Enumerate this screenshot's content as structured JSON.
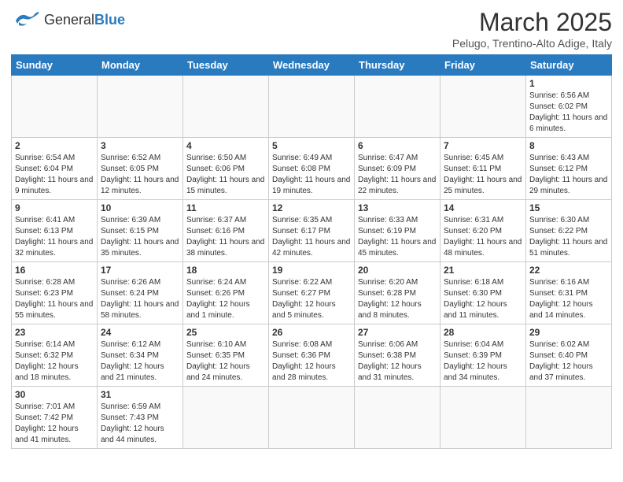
{
  "header": {
    "logo_general": "General",
    "logo_blue": "Blue",
    "month_title": "March 2025",
    "subtitle": "Pelugo, Trentino-Alto Adige, Italy"
  },
  "weekdays": [
    "Sunday",
    "Monday",
    "Tuesday",
    "Wednesday",
    "Thursday",
    "Friday",
    "Saturday"
  ],
  "weeks": [
    [
      {
        "day": "",
        "info": ""
      },
      {
        "day": "",
        "info": ""
      },
      {
        "day": "",
        "info": ""
      },
      {
        "day": "",
        "info": ""
      },
      {
        "day": "",
        "info": ""
      },
      {
        "day": "",
        "info": ""
      },
      {
        "day": "1",
        "info": "Sunrise: 6:56 AM\nSunset: 6:02 PM\nDaylight: 11 hours and 6 minutes."
      }
    ],
    [
      {
        "day": "2",
        "info": "Sunrise: 6:54 AM\nSunset: 6:04 PM\nDaylight: 11 hours and 9 minutes."
      },
      {
        "day": "3",
        "info": "Sunrise: 6:52 AM\nSunset: 6:05 PM\nDaylight: 11 hours and 12 minutes."
      },
      {
        "day": "4",
        "info": "Sunrise: 6:50 AM\nSunset: 6:06 PM\nDaylight: 11 hours and 15 minutes."
      },
      {
        "day": "5",
        "info": "Sunrise: 6:49 AM\nSunset: 6:08 PM\nDaylight: 11 hours and 19 minutes."
      },
      {
        "day": "6",
        "info": "Sunrise: 6:47 AM\nSunset: 6:09 PM\nDaylight: 11 hours and 22 minutes."
      },
      {
        "day": "7",
        "info": "Sunrise: 6:45 AM\nSunset: 6:11 PM\nDaylight: 11 hours and 25 minutes."
      },
      {
        "day": "8",
        "info": "Sunrise: 6:43 AM\nSunset: 6:12 PM\nDaylight: 11 hours and 29 minutes."
      }
    ],
    [
      {
        "day": "9",
        "info": "Sunrise: 6:41 AM\nSunset: 6:13 PM\nDaylight: 11 hours and 32 minutes."
      },
      {
        "day": "10",
        "info": "Sunrise: 6:39 AM\nSunset: 6:15 PM\nDaylight: 11 hours and 35 minutes."
      },
      {
        "day": "11",
        "info": "Sunrise: 6:37 AM\nSunset: 6:16 PM\nDaylight: 11 hours and 38 minutes."
      },
      {
        "day": "12",
        "info": "Sunrise: 6:35 AM\nSunset: 6:17 PM\nDaylight: 11 hours and 42 minutes."
      },
      {
        "day": "13",
        "info": "Sunrise: 6:33 AM\nSunset: 6:19 PM\nDaylight: 11 hours and 45 minutes."
      },
      {
        "day": "14",
        "info": "Sunrise: 6:31 AM\nSunset: 6:20 PM\nDaylight: 11 hours and 48 minutes."
      },
      {
        "day": "15",
        "info": "Sunrise: 6:30 AM\nSunset: 6:22 PM\nDaylight: 11 hours and 51 minutes."
      }
    ],
    [
      {
        "day": "16",
        "info": "Sunrise: 6:28 AM\nSunset: 6:23 PM\nDaylight: 11 hours and 55 minutes."
      },
      {
        "day": "17",
        "info": "Sunrise: 6:26 AM\nSunset: 6:24 PM\nDaylight: 11 hours and 58 minutes."
      },
      {
        "day": "18",
        "info": "Sunrise: 6:24 AM\nSunset: 6:26 PM\nDaylight: 12 hours and 1 minute."
      },
      {
        "day": "19",
        "info": "Sunrise: 6:22 AM\nSunset: 6:27 PM\nDaylight: 12 hours and 5 minutes."
      },
      {
        "day": "20",
        "info": "Sunrise: 6:20 AM\nSunset: 6:28 PM\nDaylight: 12 hours and 8 minutes."
      },
      {
        "day": "21",
        "info": "Sunrise: 6:18 AM\nSunset: 6:30 PM\nDaylight: 12 hours and 11 minutes."
      },
      {
        "day": "22",
        "info": "Sunrise: 6:16 AM\nSunset: 6:31 PM\nDaylight: 12 hours and 14 minutes."
      }
    ],
    [
      {
        "day": "23",
        "info": "Sunrise: 6:14 AM\nSunset: 6:32 PM\nDaylight: 12 hours and 18 minutes."
      },
      {
        "day": "24",
        "info": "Sunrise: 6:12 AM\nSunset: 6:34 PM\nDaylight: 12 hours and 21 minutes."
      },
      {
        "day": "25",
        "info": "Sunrise: 6:10 AM\nSunset: 6:35 PM\nDaylight: 12 hours and 24 minutes."
      },
      {
        "day": "26",
        "info": "Sunrise: 6:08 AM\nSunset: 6:36 PM\nDaylight: 12 hours and 28 minutes."
      },
      {
        "day": "27",
        "info": "Sunrise: 6:06 AM\nSunset: 6:38 PM\nDaylight: 12 hours and 31 minutes."
      },
      {
        "day": "28",
        "info": "Sunrise: 6:04 AM\nSunset: 6:39 PM\nDaylight: 12 hours and 34 minutes."
      },
      {
        "day": "29",
        "info": "Sunrise: 6:02 AM\nSunset: 6:40 PM\nDaylight: 12 hours and 37 minutes."
      }
    ],
    [
      {
        "day": "30",
        "info": "Sunrise: 7:01 AM\nSunset: 7:42 PM\nDaylight: 12 hours and 41 minutes."
      },
      {
        "day": "31",
        "info": "Sunrise: 6:59 AM\nSunset: 7:43 PM\nDaylight: 12 hours and 44 minutes."
      },
      {
        "day": "",
        "info": ""
      },
      {
        "day": "",
        "info": ""
      },
      {
        "day": "",
        "info": ""
      },
      {
        "day": "",
        "info": ""
      },
      {
        "day": "",
        "info": ""
      }
    ]
  ]
}
